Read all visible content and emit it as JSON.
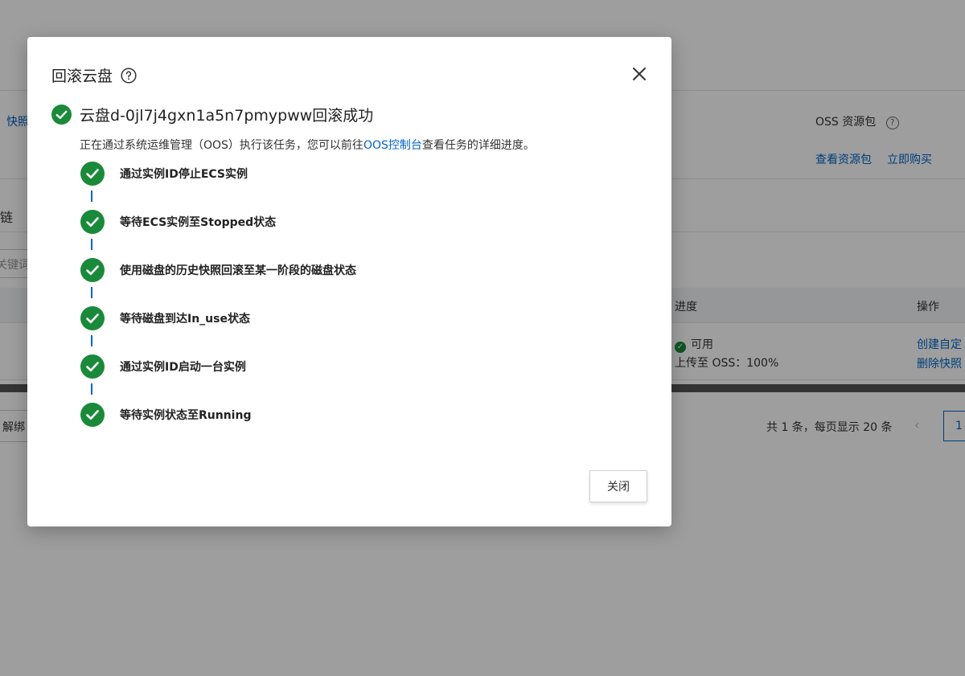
{
  "background": {
    "left_link": "快照",
    "oss_label": "OSS 资源包",
    "view_package": "查看资源包",
    "buy_now": "立即购买",
    "chain_tab": "链",
    "search_placeholder": "关键词",
    "col_progress": "进度",
    "col_actions": "操作",
    "status_available": "可用",
    "upload_progress": "上传至 OSS：100%",
    "action_create": "创建自定",
    "action_delete": "删除快照",
    "unbind_button": "解绑",
    "pager_summary": "共 1 条，每页显示 20 条",
    "pager_current": "1"
  },
  "dialog": {
    "title": "回滚云盘",
    "success_title": "云盘d-0jl7j4gxn1a5n7pmypww回滚成功",
    "desc_prefix": "正在通过系统运维管理（OOS）执行该任务，您可以前往",
    "desc_link": "OOS控制台",
    "desc_suffix": "查看任务的详细进度。",
    "steps": [
      {
        "label": "通过实例ID停止ECS实例"
      },
      {
        "label": "等待ECS实例至Stopped状态"
      },
      {
        "label": "使用磁盘的历史快照回滚至某一阶段的磁盘状态"
      },
      {
        "label": "等待磁盘到达In_use状态"
      },
      {
        "label": "通过实例ID启动一台实例"
      },
      {
        "label": "等待实例状态至Running"
      }
    ],
    "close_button": "关闭"
  },
  "colors": {
    "success_green": "#1a8a3a",
    "link_blue": "#0064c8"
  }
}
